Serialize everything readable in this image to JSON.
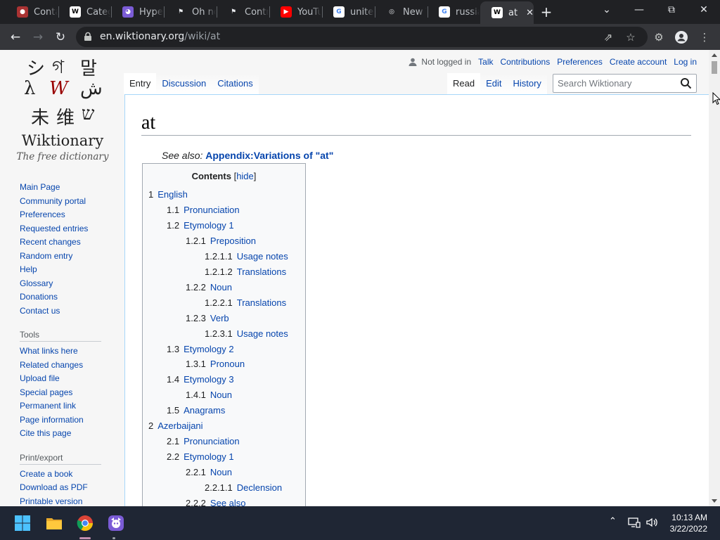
{
  "browser": {
    "tabs": [
      {
        "title": "Conta",
        "favicon": "wiki-globe-icon",
        "active": false
      },
      {
        "title": "Catego",
        "favicon": "wiktionary-icon",
        "active": false
      },
      {
        "title": "Hyper",
        "favicon": "purple-bot-icon",
        "active": false
      },
      {
        "title": "Oh no",
        "favicon": "stack-icon",
        "active": false
      },
      {
        "title": "Contro",
        "favicon": "stack-icon",
        "active": false
      },
      {
        "title": "YouTu",
        "favicon": "youtube-icon",
        "active": false
      },
      {
        "title": "united",
        "favicon": "google-icon",
        "active": false
      },
      {
        "title": "New T",
        "favicon": "chrome-icon",
        "active": false
      },
      {
        "title": "russia",
        "favicon": "google-icon",
        "active": false
      },
      {
        "title": "at",
        "favicon": "wiktionary-icon",
        "active": true
      }
    ],
    "url_host": "en.wiktionary.org",
    "url_path": "/wiki/at"
  },
  "wiki": {
    "logo": {
      "wordmark": "Wiktionary",
      "tagline": "The free dictionary"
    },
    "personal": {
      "not_logged_in": "Not logged in",
      "talk": "Talk",
      "contributions": "Contributions",
      "preferences": "Preferences",
      "create_account": "Create account",
      "log_in": "Log in"
    },
    "tabs_left": [
      "Entry",
      "Discussion",
      "Citations"
    ],
    "tabs_right": [
      "Read",
      "Edit",
      "History"
    ],
    "search_placeholder": "Search Wiktionary",
    "nav_main": [
      "Main Page",
      "Community portal",
      "Preferences",
      "Requested entries",
      "Recent changes",
      "Random entry",
      "Help",
      "Glossary",
      "Donations",
      "Contact us"
    ],
    "tools_heading": "Tools",
    "nav_tools": [
      "What links here",
      "Related changes",
      "Upload file",
      "Special pages",
      "Permanent link",
      "Page information",
      "Cite this page"
    ],
    "print_heading": "Print/export",
    "nav_print": [
      "Create a book",
      "Download as PDF",
      "Printable version"
    ],
    "heading": "at",
    "see_also_label": "See also:",
    "see_also_link": "Appendix:Variations of \"at\"",
    "toc": {
      "title": "Contents",
      "hide_open": "[",
      "hide": "hide",
      "hide_close": "]",
      "items": [
        {
          "num": "1",
          "text": "English",
          "level": 1
        },
        {
          "num": "1.1",
          "text": "Pronunciation",
          "level": 2
        },
        {
          "num": "1.2",
          "text": "Etymology 1",
          "level": 2
        },
        {
          "num": "1.2.1",
          "text": "Preposition",
          "level": 3
        },
        {
          "num": "1.2.1.1",
          "text": "Usage notes",
          "level": 4
        },
        {
          "num": "1.2.1.2",
          "text": "Translations",
          "level": 4
        },
        {
          "num": "1.2.2",
          "text": "Noun",
          "level": 3
        },
        {
          "num": "1.2.2.1",
          "text": "Translations",
          "level": 4
        },
        {
          "num": "1.2.3",
          "text": "Verb",
          "level": 3
        },
        {
          "num": "1.2.3.1",
          "text": "Usage notes",
          "level": 4
        },
        {
          "num": "1.3",
          "text": "Etymology 2",
          "level": 2
        },
        {
          "num": "1.3.1",
          "text": "Pronoun",
          "level": 3
        },
        {
          "num": "1.4",
          "text": "Etymology 3",
          "level": 2
        },
        {
          "num": "1.4.1",
          "text": "Noun",
          "level": 3
        },
        {
          "num": "1.5",
          "text": "Anagrams",
          "level": 2
        },
        {
          "num": "2",
          "text": "Azerbaijani",
          "level": 1
        },
        {
          "num": "2.1",
          "text": "Pronunciation",
          "level": 2
        },
        {
          "num": "2.2",
          "text": "Etymology 1",
          "level": 2
        },
        {
          "num": "2.2.1",
          "text": "Noun",
          "level": 3
        },
        {
          "num": "2.2.1.1",
          "text": "Declension",
          "level": 4
        },
        {
          "num": "2.2.2",
          "text": "See also",
          "level": 3
        }
      ]
    }
  },
  "taskbar": {
    "time": "10:13 AM",
    "date": "3/22/2022"
  }
}
